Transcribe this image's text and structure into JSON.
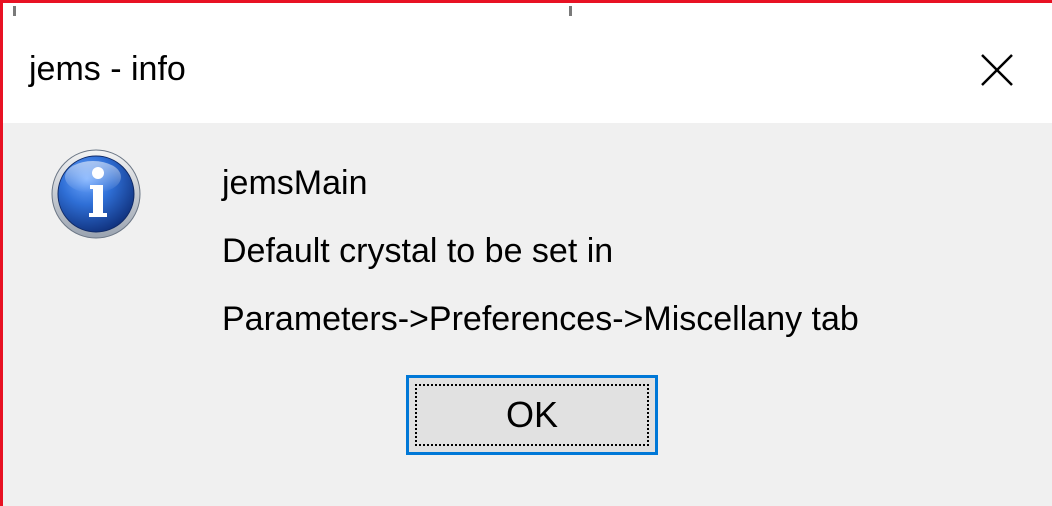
{
  "window": {
    "title": "jems - info"
  },
  "dialog": {
    "heading": "jemsMain",
    "line1": "Default crystal to be set in",
    "line2": "Parameters->Preferences->Miscellany tab",
    "ok_label": "OK",
    "icon": "info-icon"
  },
  "colors": {
    "frame_border": "#e81123",
    "titlebar_bg": "#ffffff",
    "client_bg": "#f0f0f0",
    "button_bg": "#e1e1e1",
    "button_focus_border": "#0078d7",
    "icon_blue": "#1f56b8"
  }
}
